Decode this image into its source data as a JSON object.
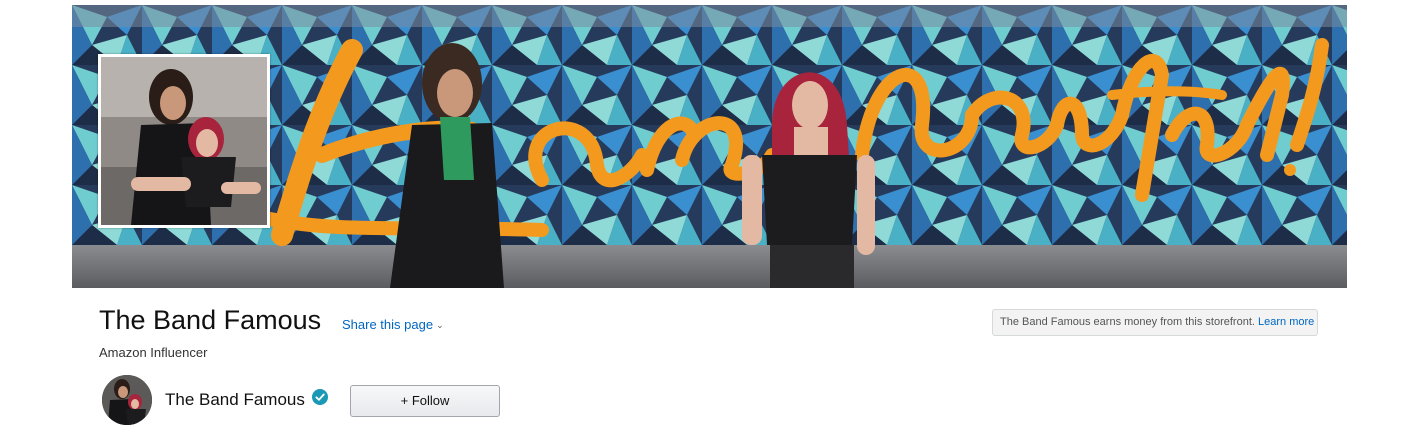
{
  "banner": {
    "mural_text": "You are beautiful!",
    "colors": {
      "wall_dark": "#1e2c44",
      "wall_teal": "#5fc4c9",
      "wall_blue": "#2f7fc1",
      "script_orange": "#f39a1e",
      "pavement": "#6b6d70"
    }
  },
  "storefront": {
    "title": "The Band Famous",
    "share_label": "Share this page",
    "subtitle": "Amazon Influencer",
    "disclosure_text": "The Band Famous earns money from this storefront.",
    "learn_more_label": "Learn more"
  },
  "creator": {
    "name": "The Band Famous",
    "verified_icon": "verified-check-icon",
    "follow_label": "+ Follow"
  },
  "theme": {
    "link_color": "#0066c0",
    "verified_color": "#1a98b5"
  }
}
